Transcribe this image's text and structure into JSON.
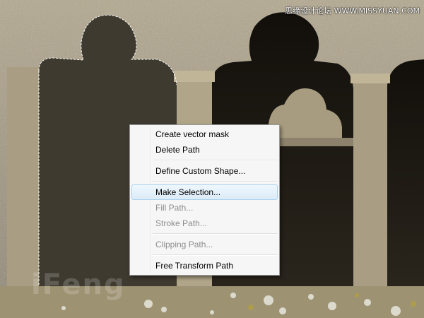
{
  "watermark": {
    "site_text": "思缘设计论坛  WWW.MISSYUAN.COM",
    "logo_text": "iFeng"
  },
  "context_menu": {
    "items": [
      {
        "label": "Create vector mask",
        "disabled": false
      },
      {
        "label": "Delete Path",
        "disabled": false
      },
      {
        "label": "Define Custom Shape...",
        "disabled": false
      },
      {
        "label": "Make Selection...",
        "disabled": false,
        "highlighted": true
      },
      {
        "label": "Fill Path...",
        "disabled": true
      },
      {
        "label": "Stroke Path...",
        "disabled": true
      },
      {
        "label": "Clipping Path...",
        "disabled": true
      },
      {
        "label": "Free Transform Path",
        "disabled": false
      }
    ]
  },
  "colors": {
    "stone": "#a69a7e",
    "shadow": "#1a1712",
    "menu_bg": "#f6f6f6",
    "highlight_border": "#a8d1ee"
  }
}
